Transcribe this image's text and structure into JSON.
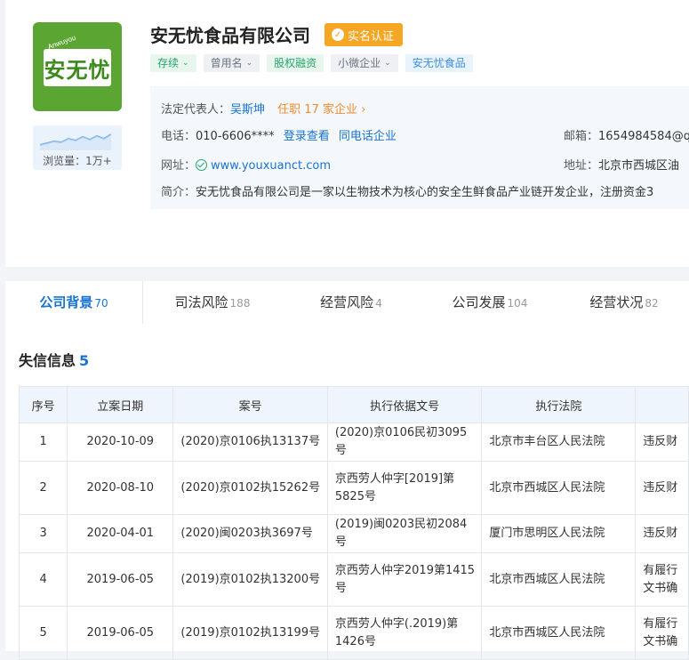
{
  "company": {
    "logo_text": "安无忧",
    "logo_sub": "Anwuyou",
    "name": "安无忧食品有限公司",
    "verified_label": "实名认证",
    "views_label": "浏览量：1万+",
    "tags": [
      {
        "label": "存续",
        "style": "green",
        "dropdown": true
      },
      {
        "label": "曾用名",
        "style": "gray",
        "dropdown": true
      },
      {
        "label": "股权融资",
        "style": "green",
        "dropdown": false
      },
      {
        "label": "小微企业",
        "style": "gray",
        "dropdown": true
      },
      {
        "label": "安无忧食品",
        "style": "blue",
        "dropdown": false
      }
    ]
  },
  "info": {
    "legal_rep_label": "法定代表人：",
    "legal_rep_name": "吴斯坤",
    "legal_rep_roles": "任职 17 家企业 ›",
    "phone_label": "电话：",
    "phone_value": "010-6606****",
    "phone_login_link": "登录查看",
    "phone_same_link": "同电话企业",
    "email_label": "邮箱：",
    "email_value": "1654984584@q",
    "website_label": "网址：",
    "website_value": "www.youxuanct.com",
    "address_label": "地址：",
    "address_value": "北京市西城区油",
    "intro_label": "简介：",
    "intro_value": "安无忧食品有限公司是一家以生物技术为核心的安全生鲜食品产业链开发企业，注册资金3"
  },
  "tabs": [
    {
      "label": "公司背景",
      "count": "70",
      "active": true
    },
    {
      "label": "司法风险",
      "count": "188",
      "active": false
    },
    {
      "label": "经营风险",
      "count": "4",
      "active": false
    },
    {
      "label": "公司发展",
      "count": "104",
      "active": false
    },
    {
      "label": "经营状况",
      "count": "82",
      "active": false
    }
  ],
  "section": {
    "title": "失信信息",
    "count": "5"
  },
  "table": {
    "headers": [
      "序号",
      "立案日期",
      "案号",
      "执行依据文号",
      "执行法院",
      ""
    ],
    "rows": [
      [
        "1",
        "2020-10-09",
        "(2020)京0106执13137号",
        "(2020)京0106民初3095号",
        "北京市丰台区人民法院",
        "违反财"
      ],
      [
        "2",
        "2020-08-10",
        "(2020)京0102执15262号",
        "京西劳人仲字[2019]第5825号",
        "北京市西城区人民法院",
        "违反财"
      ],
      [
        "3",
        "2020-04-01",
        "(2020)闽0203执3697号",
        "(2019)闽0203民初2084号",
        "厦门市思明区人民法院",
        "违反财"
      ],
      [
        "4",
        "2019-06-05",
        "(2019)京0102执13200号",
        "京西劳人仲字2019第1415号",
        "北京市西城区人民法院",
        "有履行文书确"
      ],
      [
        "5",
        "2019-06-05",
        "(2019)京0102执13199号",
        "京西劳人仲字(.2019)第1426号",
        "北京市西城区人民法院",
        "有履行文书确"
      ]
    ]
  },
  "colors": {
    "accent": "#1873d4",
    "green": "#27a36b",
    "orange": "#f28b2c",
    "logo_bg": "#5ba532"
  }
}
